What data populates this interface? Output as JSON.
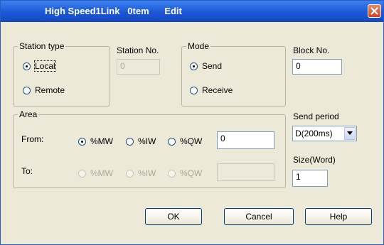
{
  "window": {
    "title": "High Speed1Link   0tem      Edit"
  },
  "station_type": {
    "legend": "Station type",
    "options": [
      {
        "label": "Local",
        "checked": true
      },
      {
        "label": "Remote",
        "checked": false
      }
    ]
  },
  "station_no": {
    "label": "Station No.",
    "value": "0"
  },
  "mode": {
    "legend": "Mode",
    "options": [
      {
        "label": "Send",
        "checked": true
      },
      {
        "label": "Receive",
        "checked": false
      }
    ]
  },
  "block_no": {
    "label": "Block No.",
    "value": "0"
  },
  "area": {
    "legend": "Area",
    "from": {
      "label": "From:",
      "options": [
        {
          "label": "%MW",
          "checked": true
        },
        {
          "label": "%IW",
          "checked": false
        },
        {
          "label": "%QW",
          "checked": false
        }
      ],
      "value": "0"
    },
    "to": {
      "label": "To:",
      "options": [
        {
          "label": "%MW",
          "checked": false
        },
        {
          "label": "%IW",
          "checked": false
        },
        {
          "label": "%QW",
          "checked": false
        }
      ],
      "value": ""
    }
  },
  "send_period": {
    "label": "Send period",
    "value": "D(200ms)"
  },
  "size": {
    "label": "Size(Word)",
    "value": "1"
  },
  "buttons": {
    "ok": "OK",
    "cancel": "Cancel",
    "help": "Help"
  },
  "icons": {
    "close": "close-icon",
    "dropdown": "chevron-down-icon"
  }
}
